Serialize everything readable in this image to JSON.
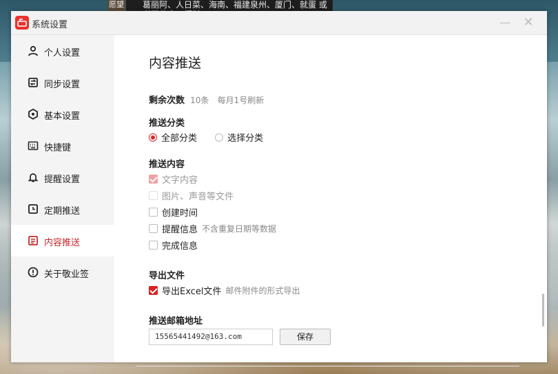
{
  "background": {
    "topnote_tab": "愿望",
    "topnote_text": "葛丽阿、人日菜、海南、福建泉州、厦门、就蛋 或者天花肉、爆料"
  },
  "window": {
    "title": "系统设置",
    "accent_color": "#d22222"
  },
  "sidebar": {
    "items": [
      {
        "label": "个人设置",
        "icon": "user-icon"
      },
      {
        "label": "同步设置",
        "icon": "sync-icon"
      },
      {
        "label": "基本设置",
        "icon": "settings-icon"
      },
      {
        "label": "快捷键",
        "icon": "keyboard-icon"
      },
      {
        "label": "提醒设置",
        "icon": "bell-icon"
      },
      {
        "label": "定期推送",
        "icon": "calendar-clock-icon"
      },
      {
        "label": "内容推送",
        "icon": "document-icon",
        "active": true
      },
      {
        "label": "关于敬业签",
        "icon": "info-icon"
      }
    ]
  },
  "content": {
    "title": "内容推送",
    "remaining": {
      "label": "剩余次数",
      "count": "10条",
      "note": "每月1号刷新"
    },
    "category": {
      "label": "推送分类",
      "options": [
        {
          "label": "全部分类",
          "selected": true
        },
        {
          "label": "选择分类",
          "selected": false
        }
      ]
    },
    "push_content": {
      "label": "推送内容",
      "options": [
        {
          "label": "文字内容",
          "checked": true,
          "disabled": true,
          "note": ""
        },
        {
          "label": "图片、声音等文件",
          "checked": false,
          "disabled": true,
          "note": ""
        },
        {
          "label": "创建时间",
          "checked": false,
          "disabled": false,
          "note": ""
        },
        {
          "label": "提醒信息",
          "checked": false,
          "disabled": false,
          "note": "不含重复日期等数据"
        },
        {
          "label": "完成信息",
          "checked": false,
          "disabled": false,
          "note": ""
        }
      ]
    },
    "export": {
      "label": "导出文件",
      "option": {
        "label": "导出Excel文件",
        "checked": true,
        "note": "邮件附件的形式导出"
      }
    },
    "email": {
      "label": "推送邮箱地址",
      "value": "15565441492@163.com",
      "save_label": "保存"
    }
  }
}
